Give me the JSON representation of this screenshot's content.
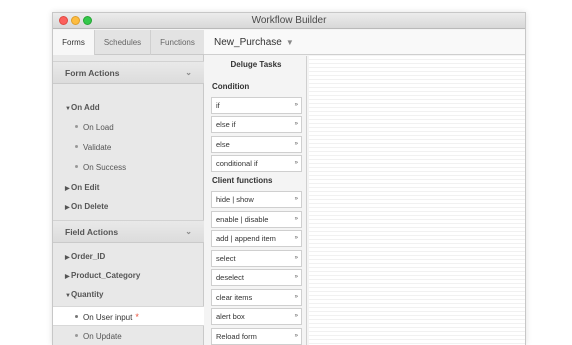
{
  "window": {
    "title": "Workflow Builder"
  },
  "tabs": [
    {
      "label": "Forms"
    },
    {
      "label": "Schedules"
    },
    {
      "label": "Functions"
    }
  ],
  "form_selector": {
    "value": "New_Purchase",
    "caret_icon": "chevron-down-icon"
  },
  "form_actions": {
    "header": "Form Actions",
    "on_add": "On Add",
    "on_add_children": [
      "On Load",
      "Validate",
      "On Success"
    ],
    "on_edit": "On Edit",
    "on_delete": "On Delete"
  },
  "field_actions": {
    "header": "Field Actions",
    "fields": [
      "Order_ID",
      "Product_Category",
      "Quantity"
    ],
    "quantity_children": [
      "On User input",
      "On Update"
    ],
    "required_marker": "*"
  },
  "deluge": {
    "title": "Deluge Tasks",
    "condition_label": "Condition",
    "conditions": [
      "if",
      "else if",
      "else",
      "conditional if"
    ],
    "client_label": "Client functions",
    "client_functions": [
      "hide | show",
      "enable | disable",
      "add | append item",
      "select",
      "deselect",
      "clear items",
      "alert box",
      "Reload form"
    ],
    "task_icon": "»"
  },
  "colors": {
    "close": "#fc605c",
    "minimize": "#fdbc40",
    "maximize": "#34c84a",
    "required": "#e8503a"
  }
}
